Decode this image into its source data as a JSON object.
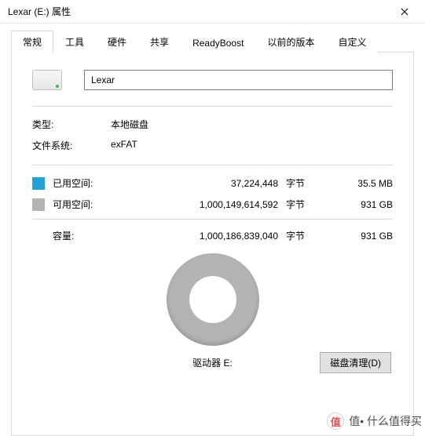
{
  "window": {
    "title": "Lexar (E:) 属性"
  },
  "tabs": [
    {
      "label": "常规",
      "active": true
    },
    {
      "label": "工具",
      "active": false
    },
    {
      "label": "硬件",
      "active": false
    },
    {
      "label": "共享",
      "active": false
    },
    {
      "label": "ReadyBoost",
      "active": false
    },
    {
      "label": "以前的版本",
      "active": false
    },
    {
      "label": "自定义",
      "active": false
    }
  ],
  "drive": {
    "name_value": "Lexar",
    "type_label": "类型:",
    "type_value": "本地磁盘",
    "fs_label": "文件系统:",
    "fs_value": "exFAT"
  },
  "space": {
    "used_label": "已用空间:",
    "used_bytes": "37,224,448",
    "used_human": "35.5 MB",
    "free_label": "可用空间:",
    "free_bytes": "1,000,149,614,592",
    "free_human": "931 GB",
    "capacity_label": "容量:",
    "capacity_bytes": "1,000,186,839,040",
    "capacity_human": "931 GB",
    "bytes_unit": "字节"
  },
  "colors": {
    "used": "#26a0da",
    "free": "#b3b3b3"
  },
  "footer": {
    "drive_label": "驱动器 E:",
    "cleanup_button": "磁盘清理(D)"
  },
  "watermark": {
    "text": "值• 什么值得买",
    "icon_text": "值"
  },
  "chart_data": {
    "type": "pie",
    "title": "",
    "series": [
      {
        "name": "已用空间",
        "value": 37224448,
        "color": "#26a0da"
      },
      {
        "name": "可用空间",
        "value": 1000149614592,
        "color": "#b3b3b3"
      }
    ],
    "total": 1000186839040,
    "unit": "bytes",
    "note": "Used fraction ≈ 0.0037%; rendered as donut that appears entirely free (grey)."
  }
}
